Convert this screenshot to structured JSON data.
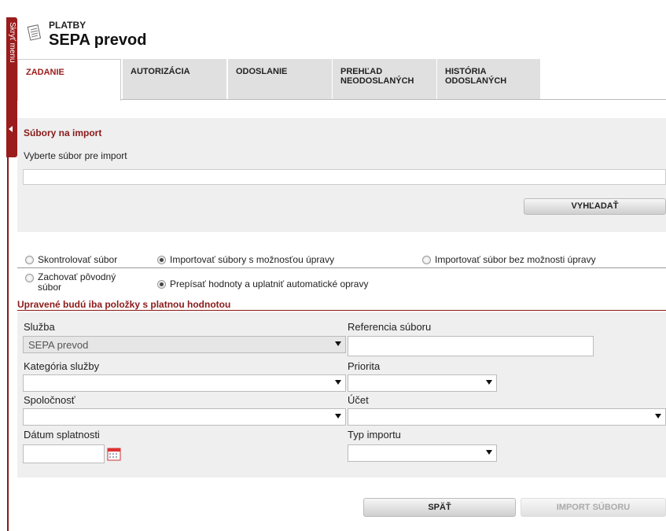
{
  "sidebar": {
    "hide_menu_label": "Skryť menu"
  },
  "header": {
    "section": "PLATBY",
    "title": "SEPA prevod",
    "icon": "document-icon"
  },
  "tabs": [
    {
      "label": "ZADANIE",
      "active": true
    },
    {
      "label": "AUTORIZÁCIA",
      "active": false
    },
    {
      "label": "ODOSLANIE",
      "active": false
    },
    {
      "label": "PREHĽAD NEODOSLANÝCH",
      "active": false
    },
    {
      "label": "HISTÓRIA ODOSLANÝCH",
      "active": false
    }
  ],
  "import_panel": {
    "title": "Súbory na import",
    "file_label": "Vyberte súbor pre import",
    "file_value": "",
    "search_button": "VYHĽADAŤ"
  },
  "options": {
    "mode_check": "Skontrolovať súbor",
    "mode_import_edit": "Importovať súbory s možnosťou úpravy",
    "mode_import_noedit": "Importovať súbor bez možnosti úpravy",
    "keep_original": "Zachovať pôvodný súbor",
    "overwrite": "Prepísať hodnoty a uplatniť automatické opravy",
    "selected_mode": "mode_import_edit",
    "selected_value_mode": "overwrite"
  },
  "form": {
    "note": "Upravené budú iba položky s platnou hodnotou",
    "service_label": "Služba",
    "service_value": "SEPA prevod",
    "file_ref_label": "Referencia súboru",
    "file_ref_value": "",
    "service_category_label": "Kategória služby",
    "service_category_value": "",
    "priority_label": "Priorita",
    "priority_value": "",
    "company_label": "Spoločnosť",
    "company_value": "",
    "account_label": "Účet",
    "account_value": "",
    "due_date_label": "Dátum splatnosti",
    "due_date_value": "",
    "import_type_label": "Typ importu",
    "import_type_value": ""
  },
  "buttons": {
    "back": "SPÄŤ",
    "import": "IMPORT SÚBORU"
  },
  "colors": {
    "accent": "#9a1c1c",
    "panel": "#efefef"
  }
}
